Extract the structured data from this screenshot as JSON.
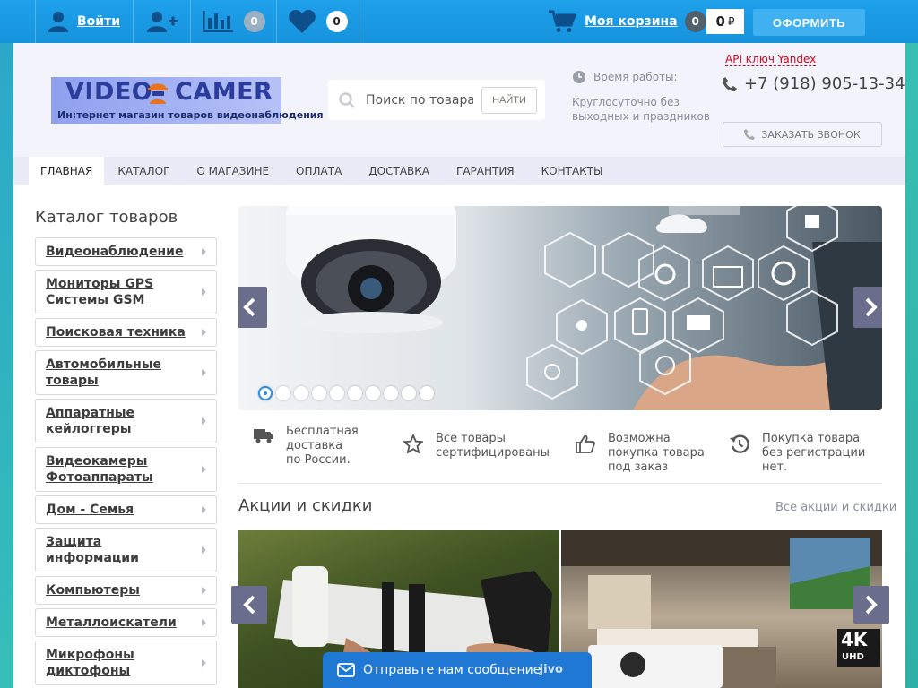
{
  "topbar": {
    "login_label": "Войти",
    "compare_count": "0",
    "favorites_count": "0",
    "cart_label": "Моя корзина",
    "cart_count": "0",
    "cart_total": "0",
    "currency": "₽",
    "checkout_label": "ОФОРМИТЬ"
  },
  "header": {
    "logo_word1": "VIDEO",
    "logo_word2": "CAMER",
    "logo_tagline": "Ин:тернет магазин товаров видеонаблюдения",
    "search_placeholder": "Поиск по товарам",
    "search_button": "НАЙТИ",
    "hours_title": "Время работы:",
    "hours_text": "Круглосуточно без выходных и праздников",
    "api_key": "API ключ Yandex",
    "phone": "+7 (918) 905-13-34",
    "callback_label": "ЗАКАЗАТЬ ЗВОНОК"
  },
  "nav": [
    {
      "label": "Главная"
    },
    {
      "label": "Каталог"
    },
    {
      "label": "О магазине"
    },
    {
      "label": "Оплата"
    },
    {
      "label": "Доставка"
    },
    {
      "label": "Гарантия"
    },
    {
      "label": "Контакты"
    }
  ],
  "sidebar": {
    "title": "Каталог товаров",
    "items": [
      {
        "label": "Видеонаблюдение"
      },
      {
        "label": "Мониторы GPS Системы GSM"
      },
      {
        "label": "Поисковая техника"
      },
      {
        "label": "Автомобильные товары"
      },
      {
        "label": "Аппаратные кейлоггеры"
      },
      {
        "label": "Видеокамеры Фотоаппараты"
      },
      {
        "label": "Дом - Семья"
      },
      {
        "label": "Защита информации"
      },
      {
        "label": "Компьютеры"
      },
      {
        "label": "Металлоискатели"
      },
      {
        "label": "Микрофоны диктофоны"
      }
    ]
  },
  "slider": {
    "slide_count": 10,
    "active_slide": 1
  },
  "features": [
    {
      "text": "Бесплатная доставка по России.",
      "icon": "truck-icon"
    },
    {
      "text": "Все товары сертифицированы",
      "icon": "star-icon"
    },
    {
      "text": "Возможна покупка товара под заказ",
      "icon": "thumbs-up-icon"
    },
    {
      "text": "Покупка товара без регистрации нет.",
      "icon": "history-icon"
    }
  ],
  "promo": {
    "title": "Акции и скидки",
    "all_link": "Все акции и скидки",
    "badge_4k": "4K",
    "badge_uhd": "UHD"
  },
  "chat": {
    "label": "Отправьте нам сообщение",
    "brand": "jivo"
  },
  "colors": {
    "topbar": "#1793dd",
    "accent_button": "#3fb0f0",
    "slider_arrow": "#6a6d8c",
    "chat": "#1e78d4",
    "api_link": "#d0021b"
  }
}
